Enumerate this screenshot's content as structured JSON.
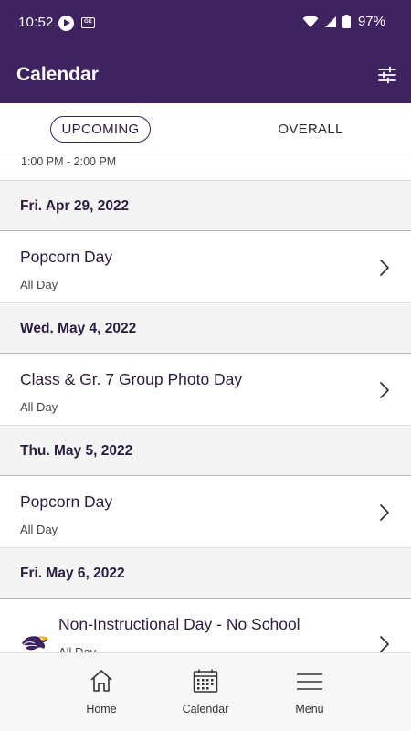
{
  "status_bar": {
    "time": "10:52",
    "battery": "97%",
    "icons": [
      "play-icon",
      "ge-icon",
      "wifi-icon",
      "signal-icon",
      "battery-icon"
    ]
  },
  "app_bar": {
    "title": "Calendar",
    "filter_icon": "filter-sliders-icon"
  },
  "tabs": [
    {
      "label": "UPCOMING",
      "selected": true
    },
    {
      "label": "OVERALL",
      "selected": false
    }
  ],
  "partial_event": {
    "time": "1:00 PM - 2:00 PM"
  },
  "days": [
    {
      "date": "Fri. Apr 29, 2022",
      "events": [
        {
          "title": "Popcorn Day",
          "time": "All Day"
        }
      ]
    },
    {
      "date": "Wed. May 4, 2022",
      "events": [
        {
          "title": "Class & Gr. 7 Group Photo Day",
          "time": "All Day"
        }
      ]
    },
    {
      "date": "Thu. May 5, 2022",
      "events": [
        {
          "title": "Popcorn Day",
          "time": "All Day"
        }
      ]
    },
    {
      "date": "Fri. May 6, 2022",
      "events": [
        {
          "title": "Non-Instructional Day - No School",
          "time": "All Day",
          "icon": "eagle-logo-icon"
        }
      ]
    }
  ],
  "bottom_nav": [
    {
      "label": "Home",
      "icon": "home-icon"
    },
    {
      "label": "Calendar",
      "icon": "calendar-icon"
    },
    {
      "label": "Menu",
      "icon": "menu-icon"
    }
  ],
  "colors": {
    "primary": "#3f2360",
    "header_text": "#2b1d40",
    "day_header_bg": "#f4f4f4"
  }
}
